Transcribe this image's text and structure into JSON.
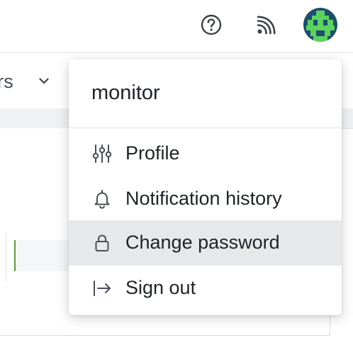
{
  "header": {
    "help_icon": "question-circle-icon",
    "feed_icon": "rss-icon",
    "avatar_icon": "identicon-avatar",
    "avatar_colors": {
      "background": "#1d4e6f",
      "pattern": "#5bd25e"
    }
  },
  "background": {
    "filter_text": "rs",
    "chevron_icon": "chevron-down-icon",
    "progress_color": "#5a9e3a"
  },
  "user_menu": {
    "username": "monitor",
    "items": [
      {
        "label": "Profile",
        "icon": "sliders-icon",
        "active": false
      },
      {
        "label": "Notification history",
        "icon": "bell-icon",
        "active": false
      },
      {
        "label": "Change password",
        "icon": "lock-icon",
        "active": true
      },
      {
        "label": "Sign out",
        "icon": "sign-out-icon",
        "active": false
      }
    ]
  }
}
